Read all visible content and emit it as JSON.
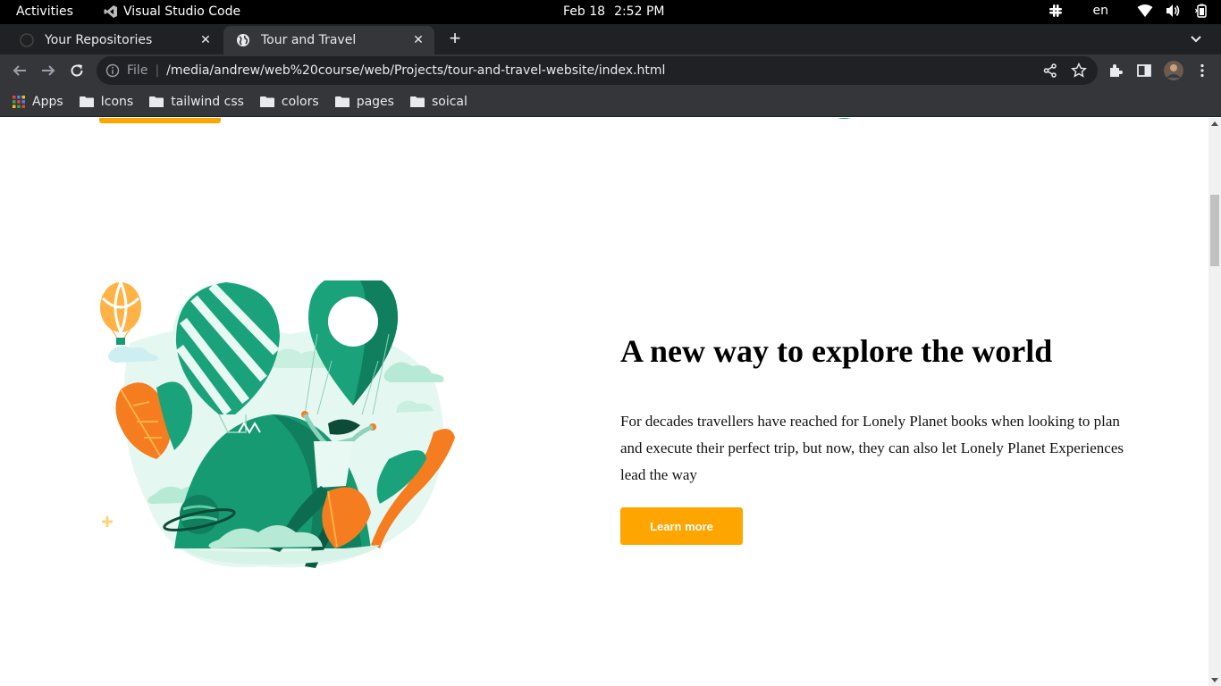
{
  "system": {
    "activities": "Activities",
    "app_name": "Visual Studio Code",
    "date": "Feb 18",
    "time": "2:52 PM",
    "language": "en"
  },
  "browser": {
    "tabs": [
      {
        "title": "Your Repositories",
        "active": false
      },
      {
        "title": "Tour and Travel",
        "active": true
      }
    ],
    "address": {
      "scheme_label": "File",
      "url": "/media/andrew/web%20course/web/Projects/tour-and-travel-website/index.html"
    },
    "bookmarks": [
      {
        "label": "Apps",
        "icon": "apps-grid-icon"
      },
      {
        "label": "Icons",
        "icon": "folder-icon"
      },
      {
        "label": "tailwind css",
        "icon": "folder-icon"
      },
      {
        "label": "colors",
        "icon": "folder-icon"
      },
      {
        "label": "pages",
        "icon": "folder-icon"
      },
      {
        "label": "soical",
        "icon": "folder-icon"
      }
    ]
  },
  "page": {
    "section": {
      "heading": "A new way to explore the world",
      "paragraph": "For decades travellers have reached for Lonely Planet books when looking to plan and execute their perfect trip, but now, they can also let Lonely Planet Experiences lead the way",
      "cta_label": "Learn more"
    },
    "colors": {
      "accent": "#ffa500",
      "illustration_green": "#1aa37a",
      "illustration_orange": "#f57c1f"
    }
  }
}
